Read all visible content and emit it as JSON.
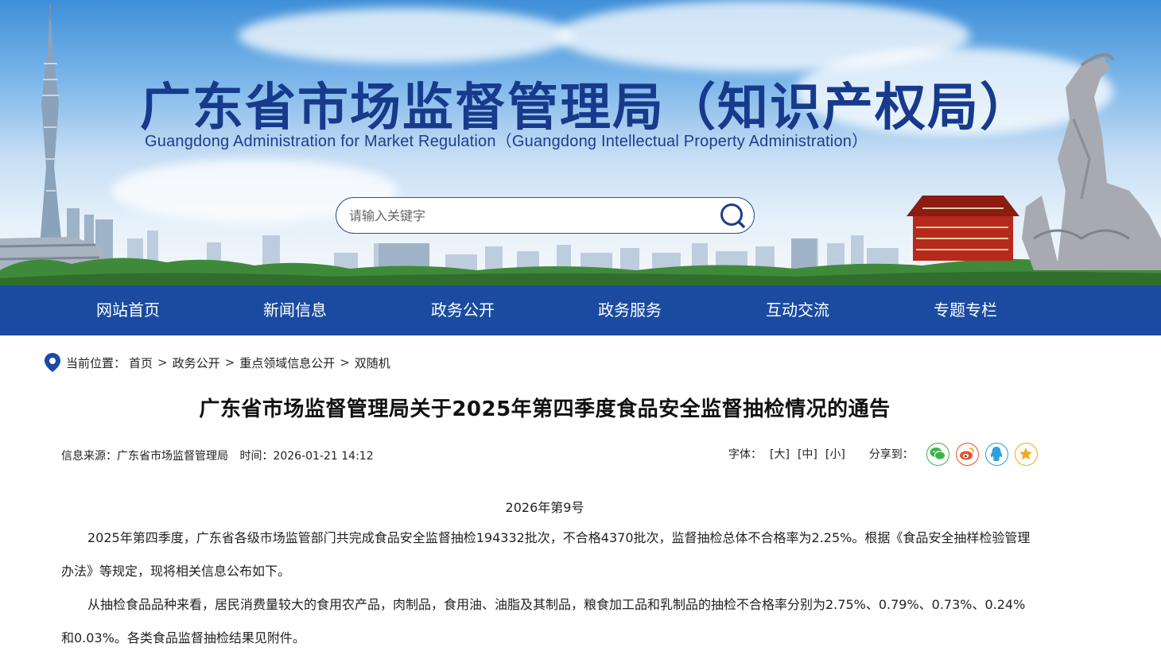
{
  "header": {
    "title": "广东省市场监督管理局（知识产权局）",
    "subtitle": "Guangdong Administration for Market Regulation（Guangdong Intellectual Property Administration）",
    "search": {
      "placeholder": "请输入关键字",
      "value": ""
    }
  },
  "nav": {
    "items": [
      "网站首页",
      "新闻信息",
      "政务公开",
      "政务服务",
      "互动交流",
      "专题专栏"
    ]
  },
  "breadcrumb": {
    "label": "当前位置：",
    "items": [
      "首页",
      "政务公开",
      "重点领域信息公开",
      "双随机"
    ],
    "separator": ">"
  },
  "article": {
    "title": "广东省市场监督管理局关于2025年第四季度食品安全监督抽检情况的通告",
    "source": "信息来源：广东省市场监督管理局",
    "time": "时间：2026-01-21 14:12",
    "font_label": "字体：",
    "font_sizes": [
      "[大]",
      "[中]",
      "[小]"
    ],
    "share_label": "分享到：",
    "share_icons": [
      "wechat-icon",
      "weibo-icon",
      "qq-icon",
      "favorite-icon"
    ],
    "doc_number": "2026年第9号",
    "paragraphs": [
      "2025年第四季度，广东省各级市场监管部门共完成食品安全监督抽检194332批次，不合格4370批次，监督抽检总体不合格率为2.25%。根据《食品安全抽样检验管理办法》等规定，现将相关信息公布如下。",
      "从抽检食品品种来看，居民消费量较大的食用农产品，肉制品，食用油、油脂及其制品，粮食加工品和乳制品的抽检不合格率分别为2.75%、0.79%、0.73%、0.24%和0.03%。各类食品监督抽检结果见附件。"
    ]
  },
  "colors": {
    "nav_bg": "#1a4ba1",
    "title_blue": "#173a8c",
    "wechat": "#3bb54a",
    "weibo": "#e8542e",
    "qq": "#2c9fe0",
    "favorite": "#f3a91c"
  }
}
